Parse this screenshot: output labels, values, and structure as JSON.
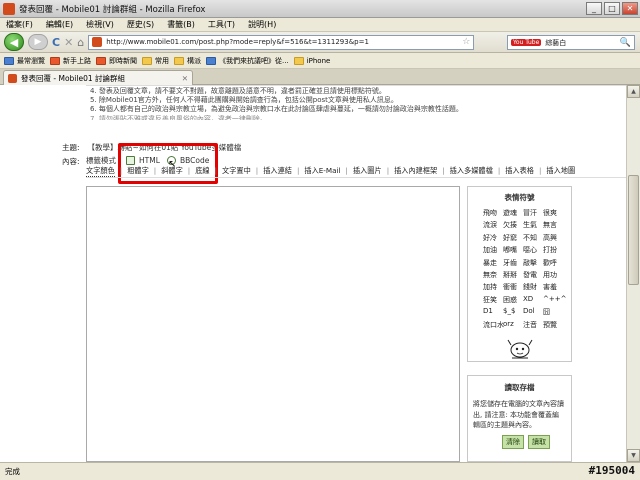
{
  "window": {
    "title": "發表回覆 - Mobile01 討論群組 - Mozilla Firefox",
    "minimize": "_",
    "maximize": "□",
    "close": "✕"
  },
  "menu": [
    "檔案(F)",
    "編輯(E)",
    "檢視(V)",
    "歷史(S)",
    "書籤(B)",
    "工具(T)",
    "說明(H)"
  ],
  "nav": {
    "url": "http://www.mobile01.com/post.php?mode=reply&f=516&t=1311293&p=1",
    "search_engine": "You Tube",
    "search_query": "綜藝白",
    "icons": {
      "back": "◀",
      "forward": "▶",
      "reload": "C",
      "stop": "✕",
      "home": "⌂",
      "star": "☆",
      "search": "🔍"
    }
  },
  "bookmarks": [
    "最常瀏覽",
    "新手上路",
    "即時新聞",
    "常用",
    "構派",
    "《我們來抗議吧》從...",
    "iPhone"
  ],
  "tab": {
    "label": "發表回覆 - Mobile01 討論群組",
    "close": "✕"
  },
  "rules": [
    "4. 發表及回覆文章，請不要文不對題，故意離題及語意不明，違者罰正確並且請使用標點符號。",
    "5. 除Mobile01官方外，任何人不得藉此團購與開始調查行為，包括公開post文章與使用私人訊息。",
    "6. 每個人都有自己的政治與宗教立場，為避免政治與宗教口水在此討論區肆虐與蔓延，一概請勿討論政治與宗教性話題。",
    "7. 請勿張貼不雅或違反善良風俗的內容，違者一律刪除。"
  ],
  "form": {
    "subject_label": "主題:",
    "subject_value": "【教學】轉貼~如何在01貼 YouTube多媒體檔",
    "content_label": "內容:",
    "mode_label": "標籤模式",
    "mode_html": "HTML",
    "mode_bbcode": "BBCode"
  },
  "toolbar": [
    "文字顏色",
    "粗體字",
    "斜體字",
    "底線",
    "文字置中",
    "插入連結",
    "插入E-Mail",
    "插入圖片",
    "插入內建框架",
    "插入多媒體檔",
    "插入表格",
    "插入地圖"
  ],
  "emoticons": {
    "title": "表情符號",
    "items": [
      "飛吻",
      "遊魂",
      "冒汗",
      "很爽",
      "流淚",
      "欠揍",
      "生氣",
      "無言",
      "好冷",
      "好窮",
      "不知",
      "高興",
      "加油",
      "嘟嘴",
      "噁心",
      "打扮",
      "暴走",
      "牙齒",
      "敲擊",
      "歡呼",
      "無奈",
      "掰掰",
      "發電",
      "用功",
      "加持",
      "衝衝",
      "錢財",
      "害羞",
      "狂笑",
      "困惑",
      "XD",
      "^++^",
      "D1",
      "$_$",
      "Dol",
      "囧",
      "流口水",
      "orz",
      "注音",
      "預覽"
    ]
  },
  "draft": {
    "title": "讀取存檔",
    "desc": "將您儲存在電腦的文章內容讀出, 請注意: 本功能會覆蓋編輯區的主題與內容。",
    "clear": "清除",
    "load": "讀取"
  },
  "status": "完成",
  "watermark": "#195004"
}
